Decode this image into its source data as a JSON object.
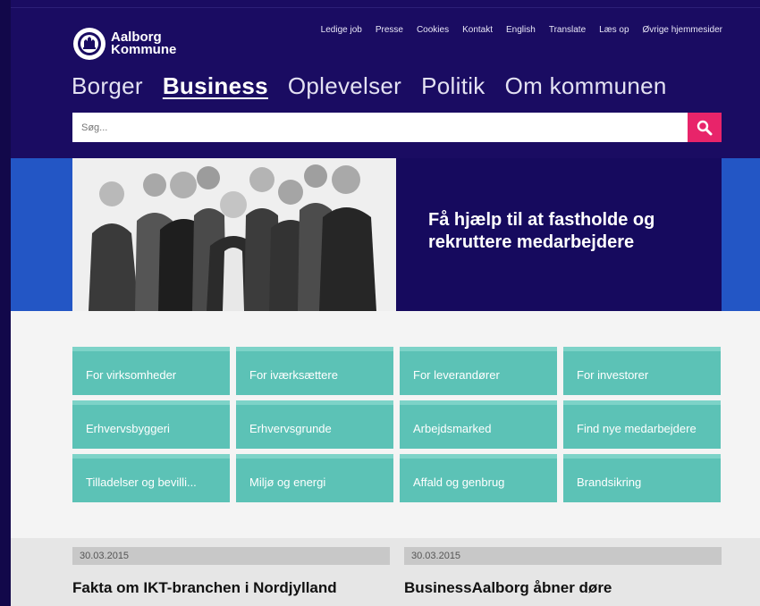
{
  "brand": {
    "name_line1": "Aalborg",
    "name_line2": "Kommune"
  },
  "utility_nav": [
    "Ledige job",
    "Presse",
    "Cookies",
    "Kontakt",
    "English",
    "Translate",
    "Læs op",
    "Øvrige hjemmesider"
  ],
  "main_nav": [
    {
      "label": "Borger",
      "active": false
    },
    {
      "label": "Business",
      "active": true
    },
    {
      "label": "Oplevelser",
      "active": false
    },
    {
      "label": "Politik",
      "active": false
    },
    {
      "label": "Om kommunen",
      "active": false
    }
  ],
  "search": {
    "placeholder": "Søg...",
    "button_icon": "search-icon"
  },
  "hero": {
    "headline": "Få hjælp til at fastholde og rekruttere medarbejdere"
  },
  "tiles": [
    "For virksomheder",
    "For iværksættere",
    "For leverandører",
    "For investorer",
    "Erhvervsbyggeri",
    "Erhvervsgrunde",
    "Arbejdsmarked",
    "Find nye medarbejdere",
    "Tilladelser og bevilli...",
    "Miljø og energi",
    "Affald og genbrug",
    "Brandsikring"
  ],
  "news": [
    {
      "date": "30.03.2015",
      "title": "Fakta om IKT-branchen i Nordjylland"
    },
    {
      "date": "30.03.2015",
      "title": "BusinessAalborg åbner døre"
    }
  ],
  "colors": {
    "header_bg": "#1a0c62",
    "search_button": "#e8246a",
    "tile_bg": "#5cc2b6",
    "hero_band": "#2356c5",
    "hero_panel": "#160a5e"
  }
}
